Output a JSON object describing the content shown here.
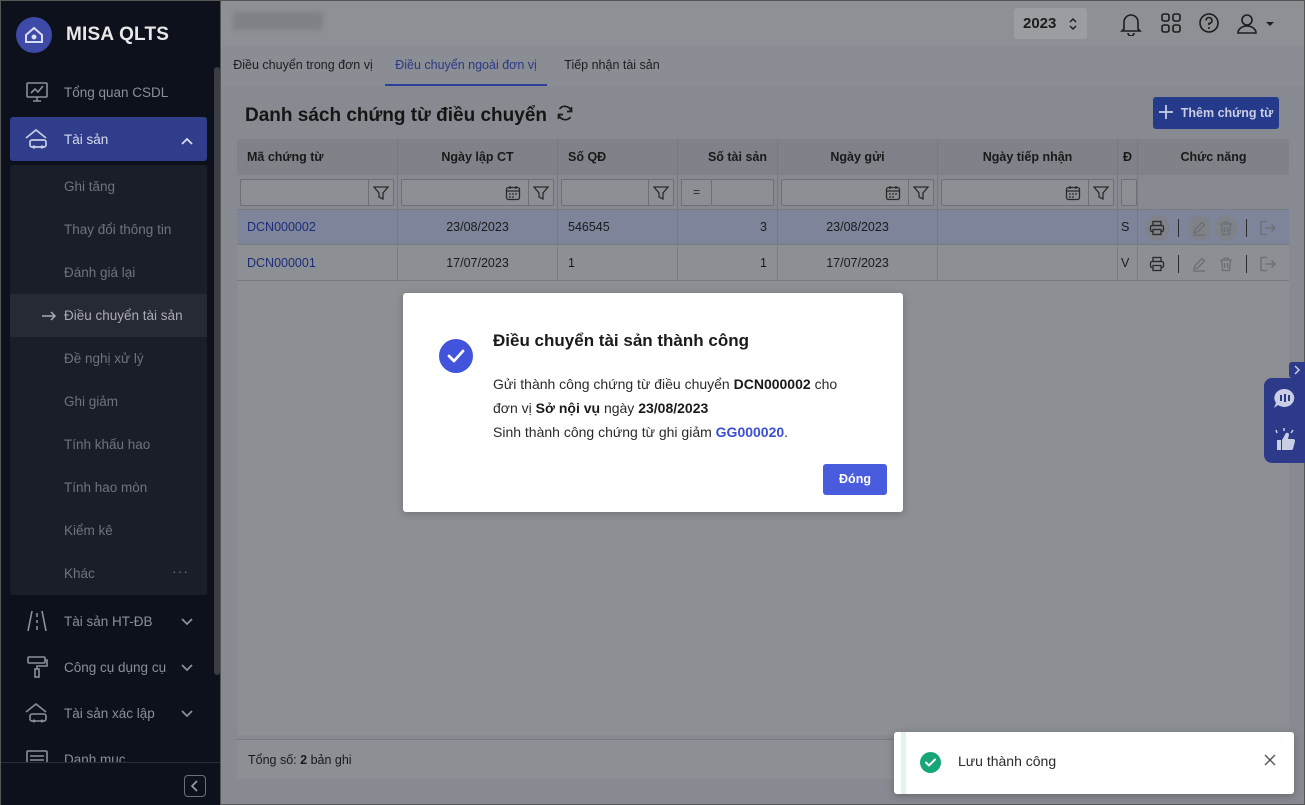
{
  "app": {
    "name": "MISA QLTS"
  },
  "colors": {
    "primary": "#4a5cde",
    "success": "#17a679",
    "link": "#3b4fd1",
    "sidebar_bg": "#0d111c"
  },
  "sidebar": {
    "items": [
      {
        "label": "Tổng quan CSDL",
        "icon": "monitor-chart-icon"
      },
      {
        "label": "Tài sản",
        "icon": "house-car-icon",
        "active": true
      },
      {
        "label": "Tài sản HT-ĐB",
        "icon": "road-icon"
      },
      {
        "label": "Công cụ dụng cụ",
        "icon": "paint-roller-icon"
      },
      {
        "label": "Tài sản xác lập",
        "icon": "house-car-icon"
      },
      {
        "label": "Danh mục",
        "icon": "list-icon"
      }
    ],
    "sub_items": [
      "Ghi tăng",
      "Thay đổi thông tin",
      "Đánh giá lại",
      "Điều chuyển tài sản",
      "Đề nghị xử lý",
      "Ghi giảm",
      "Tính khấu hao",
      "Tính hao mòn",
      "Kiểm kê",
      "Khác"
    ],
    "more_label": "···"
  },
  "header": {
    "year": "2023"
  },
  "tabs": [
    {
      "label": "Điều chuyển trong đơn vị"
    },
    {
      "label": "Điều chuyển ngoài đơn vị",
      "active": true
    },
    {
      "label": "Tiếp nhận tài sản"
    }
  ],
  "main": {
    "title": "Danh sách chứng từ điều chuyển",
    "add_button": "Thêm chứng từ",
    "filter_eq": "=",
    "columns": [
      "Mã chứng từ",
      "Ngày lập CT",
      "Số QĐ",
      "Số tài sản",
      "Ngày gửi",
      "Ngày tiếp nhận",
      "Đ",
      "Chức năng"
    ],
    "rows": [
      {
        "code": "DCN000002",
        "date": "23/08/2023",
        "decision": "546545",
        "count": "3",
        "sent": "23/08/2023",
        "received": "",
        "unit": "S"
      },
      {
        "code": "DCN000001",
        "date": "17/07/2023",
        "decision": "1",
        "count": "1",
        "sent": "17/07/2023",
        "received": "",
        "unit": "V"
      }
    ],
    "footer": {
      "prefix": "Tổng số:",
      "count": "2",
      "suffix": "bản ghi"
    }
  },
  "modal": {
    "title": "Điều chuyển tài sản thành công",
    "line1_a": "Gửi thành công chứng từ điều chuyển",
    "line1_code": "DCN000002",
    "line1_b": "cho",
    "line2_a": "đơn vị",
    "line2_unit": "Sở nội vụ",
    "line2_b": "ngày",
    "line2_date": "23/08/2023",
    "line3_a": "Sinh thành công chứng từ ghi giảm",
    "line3_code": "GG000020",
    "ok_button": "Đóng"
  },
  "toast": {
    "message": "Lưu thành công"
  }
}
